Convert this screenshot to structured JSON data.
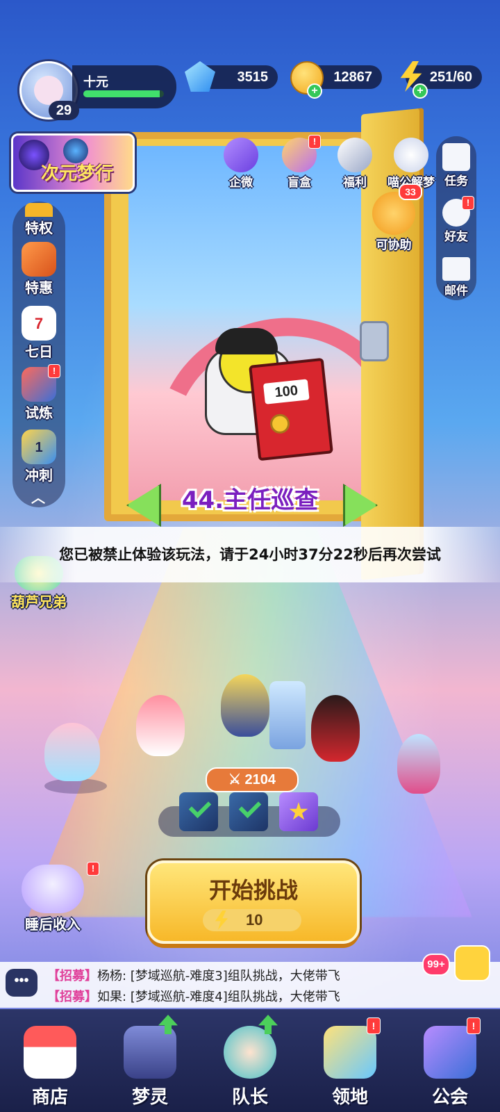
{
  "player": {
    "name": "十元",
    "level": "29",
    "exp_fraction": 0.95
  },
  "resources": {
    "gems": "3515",
    "coins": "12867",
    "energy": "251/60"
  },
  "event_banner": {
    "label": "次元梦行"
  },
  "top_buttons": [
    {
      "label": "企微",
      "icon": "gift-icon",
      "badge": ""
    },
    {
      "label": "盲盒",
      "icon": "card-box-icon",
      "badge": "!"
    },
    {
      "label": "福利",
      "icon": "gift-bag-icon",
      "badge": ""
    },
    {
      "label": "喵公解梦",
      "icon": "cat-icon",
      "badge": ""
    }
  ],
  "assist": {
    "label": "可协助",
    "badge": "33",
    "icon": "handshake-icon"
  },
  "right_rail": [
    {
      "label": "任务",
      "icon": "task-icon",
      "badge": ""
    },
    {
      "label": "好友",
      "icon": "friends-icon",
      "badge": "!"
    },
    {
      "label": "邮件",
      "icon": "mail-icon",
      "badge": ""
    }
  ],
  "left_rail": [
    {
      "label": "特权",
      "icon": "crown-icon",
      "badge": ""
    },
    {
      "label": "特惠",
      "icon": "sale-box-icon",
      "badge": ""
    },
    {
      "label": "七日",
      "icon": "calendar-icon",
      "badge": "",
      "day": "7"
    },
    {
      "label": "试炼",
      "icon": "cannon-icon",
      "badge": "!"
    },
    {
      "label": "冲刺",
      "icon": "flag-icon",
      "badge": "",
      "day": "1"
    }
  ],
  "side_event": {
    "label": "葫芦兄弟"
  },
  "stage": {
    "title": "44.主任巡查",
    "book_label": "100"
  },
  "toast": "您已被禁止体验该玩法，请于24小时37分22秒后再次尝试",
  "team": {
    "power": "2104"
  },
  "start_button": {
    "label": "开始挑战",
    "cost": "10"
  },
  "sleep_income": {
    "label": "睡后收入",
    "badge": "!"
  },
  "chat": {
    "lines": [
      {
        "tag": "【招募】",
        "text": "杨杨: [梦域巡航-难度3]组队挑战，大佬带飞"
      },
      {
        "tag": "【招募】",
        "text": "如果: [梦域巡航-难度4]组队挑战，大佬带飞"
      }
    ],
    "unread": "99+"
  },
  "bottom_nav": [
    {
      "label": "商店",
      "icon": "shop-icon",
      "indicator": ""
    },
    {
      "label": "梦灵",
      "icon": "spirit-machine-icon",
      "indicator": "up"
    },
    {
      "label": "队长",
      "icon": "captain-icon",
      "indicator": "up"
    },
    {
      "label": "领地",
      "icon": "territory-icon",
      "indicator": "!"
    },
    {
      "label": "公会",
      "icon": "guild-icon",
      "indicator": "!"
    }
  ],
  "colors": {
    "accent_green": "#41e06c",
    "badge_red": "#ff3b3b",
    "title_purple": "#7b1fbf",
    "button_gold": "#f7b829"
  }
}
